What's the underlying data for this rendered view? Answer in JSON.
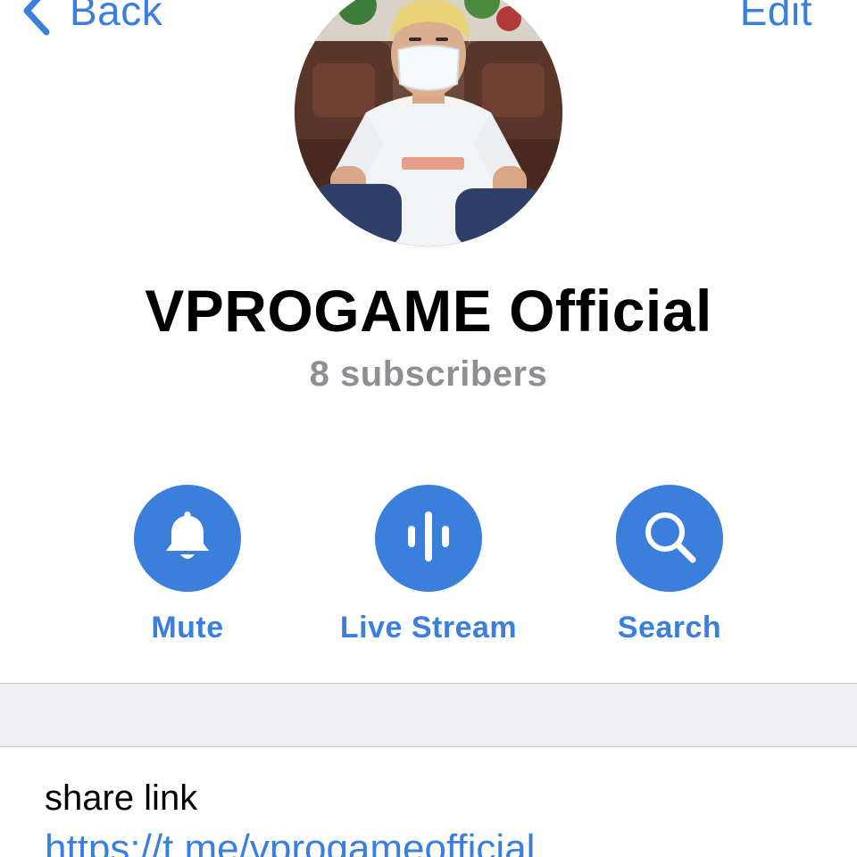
{
  "nav": {
    "back_label": "Back",
    "edit_label": "Edit"
  },
  "profile": {
    "title": "VPROGAME Official",
    "subscribers": "8 subscribers"
  },
  "actions": [
    {
      "label": "Mute",
      "icon": "bell-icon"
    },
    {
      "label": "Live Stream",
      "icon": "live-stream-icon"
    },
    {
      "label": "Search",
      "icon": "search-icon"
    }
  ],
  "share": {
    "label": "share link",
    "url": "https://t.me/vprogameofficial"
  },
  "colors": {
    "accent": "#3a7fdc",
    "secondary_text": "#8e8e93",
    "section_background": "#efeff4"
  }
}
